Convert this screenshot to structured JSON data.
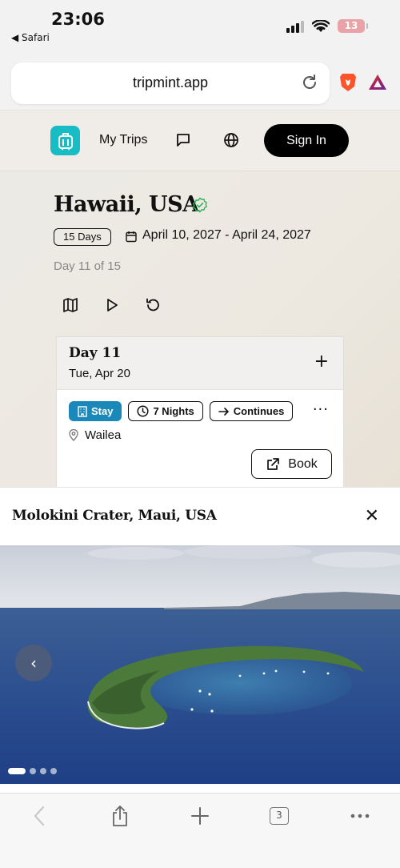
{
  "status": {
    "time": "23:06",
    "back_label": "◀ Safari",
    "battery": "13"
  },
  "browser": {
    "url": "tripmint.app",
    "tab_count": "3"
  },
  "nav": {
    "my_trips": "My Trips",
    "sign_in": "Sign In"
  },
  "trip": {
    "title": "Hawaii, USA",
    "duration": "15 Days",
    "dates": "April 10, 2027 - April 24, 2027",
    "progress": "Day 11 of 15"
  },
  "day_card": {
    "day": "Day 11",
    "date": "Tue, Apr 20",
    "tags": {
      "stay": "Stay",
      "nights": "7 Nights",
      "continues": "Continues"
    },
    "location": "Wailea",
    "book": "Book"
  },
  "sheet": {
    "title": "Molokini Crater, Maui, USA",
    "image_count": 4,
    "active_image": 1
  },
  "colors": {
    "accent": "#18bcc4",
    "stay_tag": "#1a88b8",
    "verified": "#2fb35a"
  },
  "icons": [
    "luggage-icon",
    "chat-icon",
    "globe-icon",
    "verified-icon",
    "calendar-icon",
    "map-icon",
    "play-icon",
    "reset-icon",
    "plus-icon",
    "hotel-icon",
    "clock-icon",
    "arrow-right-icon",
    "more-icon",
    "pin-icon",
    "external-link-icon",
    "close-icon",
    "chevron-left-icon",
    "share-icon",
    "tabs-icon",
    "reload-icon"
  ]
}
